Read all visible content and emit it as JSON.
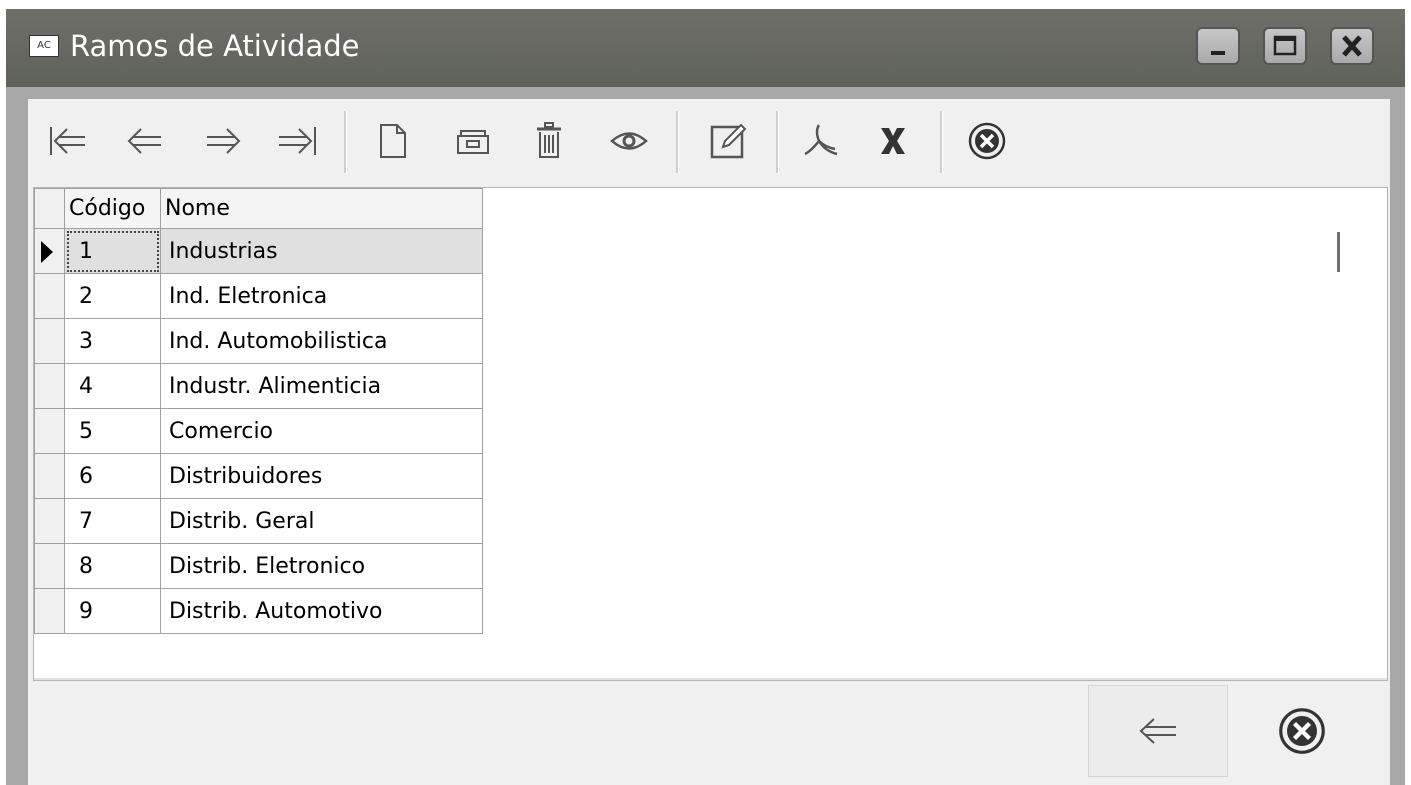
{
  "window": {
    "app_icon_text": "AC",
    "title": "Ramos de Atividade"
  },
  "toolbar": {
    "buttons": [
      "first-icon",
      "prior-icon",
      "next-icon",
      "last-icon",
      "new-document-icon",
      "open-icon",
      "delete-icon",
      "view-icon",
      "edit-icon",
      "pdf-icon",
      "excel-icon",
      "close-icon"
    ]
  },
  "grid": {
    "columns": [
      "Código",
      "Nome"
    ],
    "rows": [
      {
        "codigo": "1",
        "nome": "Industrias"
      },
      {
        "codigo": "2",
        "nome": "Ind. Eletronica"
      },
      {
        "codigo": "3",
        "nome": "Ind. Automobilistica"
      },
      {
        "codigo": "4",
        "nome": "Industr. Alimenticia"
      },
      {
        "codigo": "5",
        "nome": "Comercio"
      },
      {
        "codigo": "6",
        "nome": "Distribuidores"
      },
      {
        "codigo": "7",
        "nome": "Distrib. Geral"
      },
      {
        "codigo": "8",
        "nome": "Distrib. Eletronico"
      },
      {
        "codigo": "9",
        "nome": "Distrib. Automotivo"
      }
    ],
    "selected_row": 1
  },
  "colors": {
    "titlebar": "#666862",
    "frame": "#a8a8a8",
    "client": "#f0f0f0",
    "selected_row": "#e0e0e0"
  }
}
